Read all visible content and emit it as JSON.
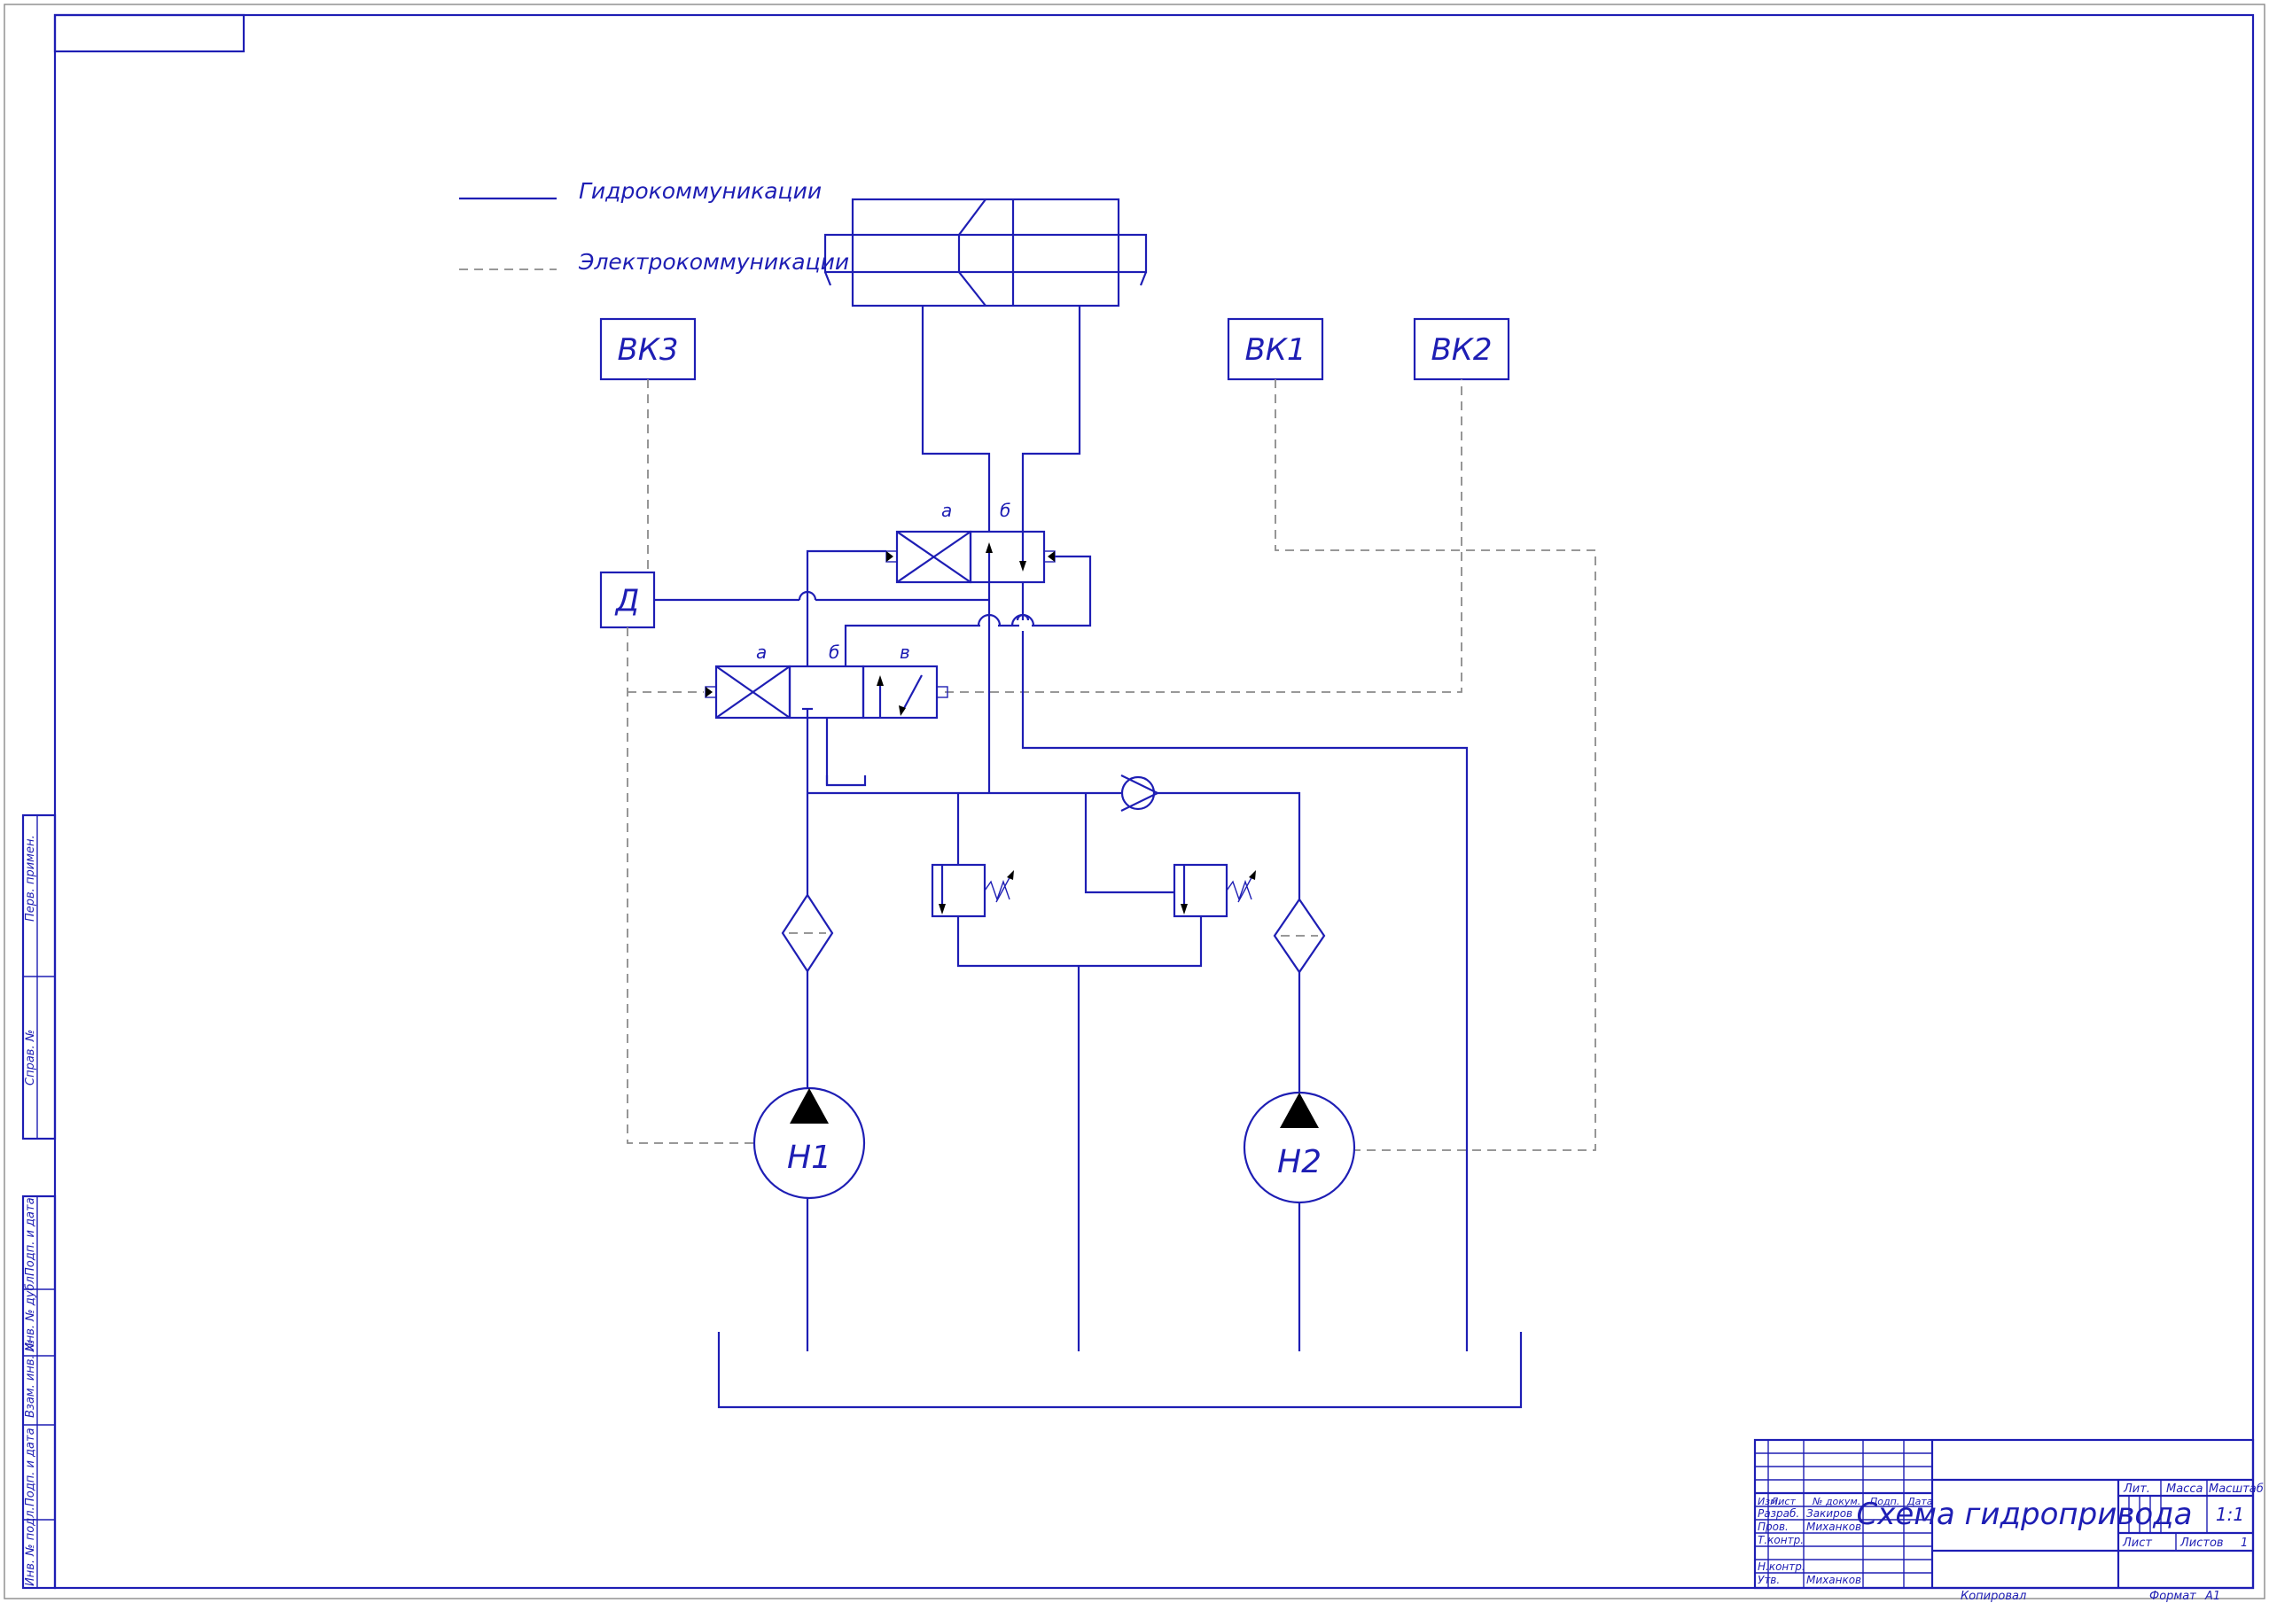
{
  "legend": {
    "hydraulic": "Гидрокоммуникации",
    "electric": "Электрокоммуникации"
  },
  "blocks": {
    "vk3": "ВК3",
    "vk1": "ВК1",
    "vk2": "ВК2",
    "d": "Д",
    "h1": "Н1",
    "h2": "Н2"
  },
  "valve_top": {
    "a": "а",
    "b": "б"
  },
  "valve_bottom": {
    "a": "а",
    "b": "б",
    "v": "в"
  },
  "side_stamp": [
    "Перв. примен.",
    "Справ. №",
    "Подп. и дата",
    "Инв. № дубл.",
    "Взам. инв. №",
    "Подп. и дата",
    "Инв. № подл."
  ],
  "title_block": {
    "title": "Схема гидропривода",
    "head": {
      "izm": "Изм.",
      "list": "Лист",
      "ndoc": "№ докум.",
      "podp": "Подп.",
      "data": "Дата"
    },
    "rows": [
      {
        "role": "Разраб.",
        "name": "Закиров"
      },
      {
        "role": "Пров.",
        "name": "Миханков"
      },
      {
        "role": "Т.контр.",
        "name": ""
      },
      {
        "role": "Н.контр.",
        "name": ""
      },
      {
        "role": "Утв.",
        "name": "Миханков"
      }
    ],
    "lit": "Лит.",
    "massa": "Масса",
    "masshtab": "Масштаб",
    "scale": "1:1",
    "sheet": "Лист",
    "sheets": "Листов",
    "sheets_count": "1",
    "copied": "Копировал",
    "format": "Формат",
    "format_value": "А1"
  },
  "colors": {
    "line": "#1e1eb4",
    "dashed": "#8a8a8a",
    "background": "#ffffff"
  }
}
